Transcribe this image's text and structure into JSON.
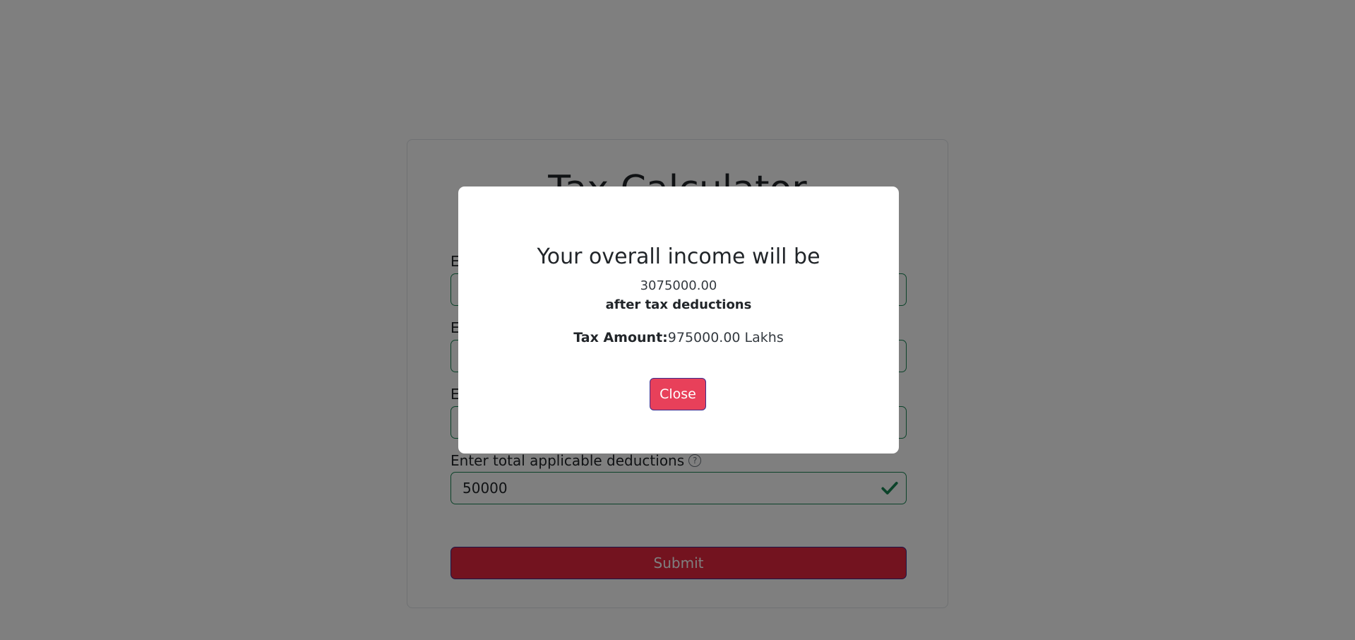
{
  "form": {
    "title": "Tax Calculator",
    "fields": [
      {
        "label": "E",
        "value": ""
      },
      {
        "label": "E",
        "value": ""
      },
      {
        "label": "E",
        "value": ""
      },
      {
        "label": "Enter total applicable deductions",
        "value": "50000",
        "help_icon": "?"
      }
    ],
    "submit_label": "Submit"
  },
  "modal": {
    "heading": "Your overall income will be",
    "amount": "3075000.00",
    "subtext": "after tax deductions",
    "tax_label": "Tax Amount:",
    "tax_value": "975000.00 Lakhs",
    "close_label": "Close"
  },
  "colors": {
    "accent": "#e8405a",
    "valid": "#198754",
    "backdrop": "rgba(0,0,0,0.5)"
  },
  "icons": {
    "valid": "check-icon",
    "help": "help-circle-icon"
  }
}
